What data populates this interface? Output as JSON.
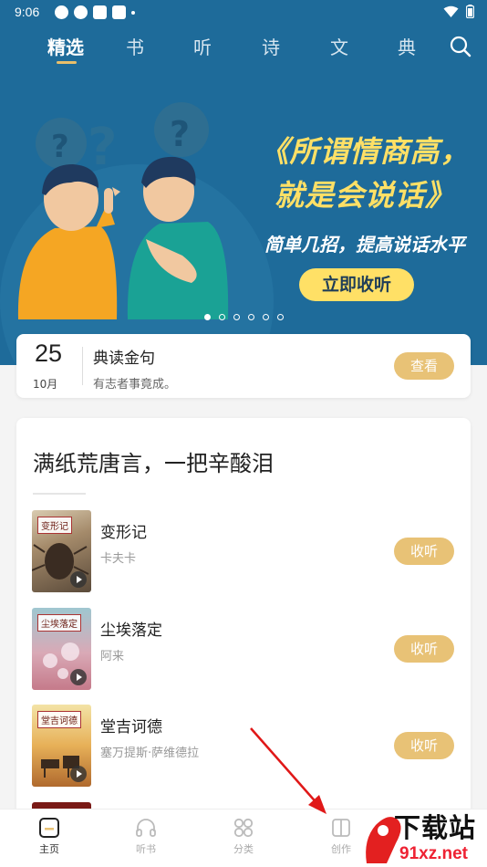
{
  "status_bar": {
    "time": "9:06"
  },
  "tabs": [
    {
      "label": "精选"
    },
    {
      "label": "书"
    },
    {
      "label": "听"
    },
    {
      "label": "诗"
    },
    {
      "label": "文"
    },
    {
      "label": "典"
    }
  ],
  "banner": {
    "title_line1": "《所谓情商高，",
    "title_line2": "就是会说话》",
    "subtitle": "简单几招，提高说话水平",
    "cta_label": "立即收听",
    "page_count": 6,
    "active_page": 1
  },
  "daily_quote": {
    "day": "25",
    "month": "10月",
    "title": "典读金句",
    "text": "有志者事竟成。",
    "button_label": "查看"
  },
  "collection": {
    "title": "满纸荒唐言，一把辛酸泪",
    "books": [
      {
        "cover_label": "变形记",
        "title": "变形记",
        "author": "卡夫卡",
        "button_label": "收听"
      },
      {
        "cover_label": "尘埃落定",
        "title": "尘埃落定",
        "author": "阿来",
        "button_label": "收听"
      },
      {
        "cover_label": "堂吉诃德",
        "title": "堂吉诃德",
        "author": "塞万提斯·萨维德拉",
        "button_label": "收听"
      }
    ]
  },
  "bottom_nav": {
    "items": [
      {
        "label": "主页",
        "icon": "home-icon"
      },
      {
        "label": "听书",
        "icon": "headphones-icon"
      },
      {
        "label": "分类",
        "icon": "grid-icon"
      },
      {
        "label": "创作",
        "icon": "book-icon"
      }
    ],
    "active": 0
  },
  "watermark": {
    "line1": "下载站",
    "line2": "91xz.net"
  },
  "colors": {
    "header_blue": "#1e6b9a",
    "accent_gold": "#e8c276",
    "banner_yellow": "#ffe066"
  }
}
